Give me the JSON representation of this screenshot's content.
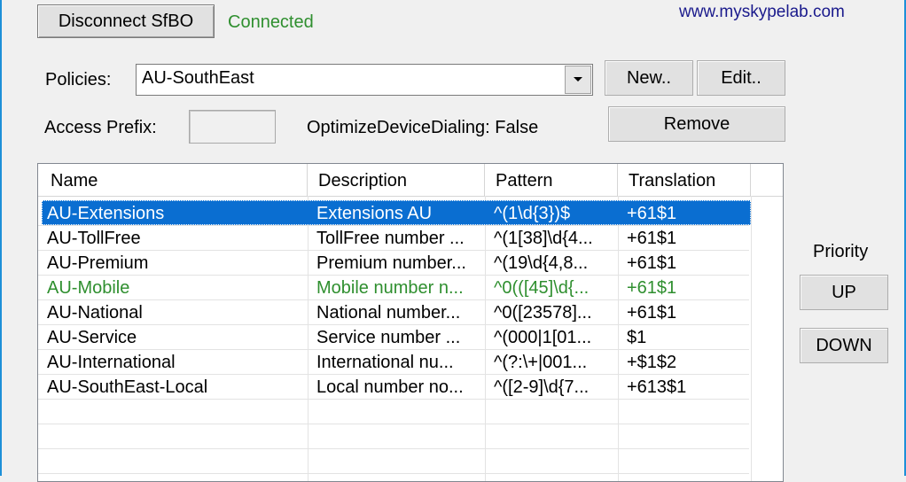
{
  "toolbar": {
    "disconnect_label": "Disconnect SfBO",
    "status_text": "Connected",
    "site_link": "www.myskypelab.com"
  },
  "policy": {
    "label": "Policies:",
    "selected": "AU-SouthEast",
    "new_label": "New..",
    "edit_label": "Edit..",
    "remove_label": "Remove",
    "access_prefix_label": "Access Prefix:",
    "access_prefix_value": "",
    "optimize_text": "OptimizeDeviceDialing: False"
  },
  "rules": {
    "columns": [
      "Name",
      "Description",
      "Pattern",
      "Translation"
    ],
    "rows": [
      {
        "name": "AU-Extensions",
        "description": "Extensions AU",
        "pattern": "^(1\\d{3})$",
        "translation": "+61$1"
      },
      {
        "name": "AU-TollFree",
        "description": "TollFree number ...",
        "pattern": "^(1[38]\\d{4...",
        "translation": "+61$1"
      },
      {
        "name": "AU-Premium",
        "description": "Premium number...",
        "pattern": "^(19\\d{4,8...",
        "translation": "+61$1"
      },
      {
        "name": "AU-Mobile",
        "description": "Mobile number n...",
        "pattern": "^0(([45]\\d{...",
        "translation": "+61$1"
      },
      {
        "name": "AU-National",
        "description": "National number...",
        "pattern": "^0([23578]...",
        "translation": "+61$1"
      },
      {
        "name": "AU-Service",
        "description": "Service number ...",
        "pattern": "^(000|1[01...",
        "translation": "$1"
      },
      {
        "name": "AU-International",
        "description": "International nu...",
        "pattern": "^(?:\\+|001...",
        "translation": "+$1$2"
      },
      {
        "name": "AU-SouthEast-Local",
        "description": "Local number no...",
        "pattern": "^([2-9]\\d{7...",
        "translation": "+613$1"
      }
    ]
  },
  "priority": {
    "label": "Priority",
    "up_label": "UP",
    "down_label": "DOWN"
  },
  "colors": {
    "selection": "#0a6ed1",
    "status_ok": "#2f8f2f",
    "link": "#1a1a8c"
  }
}
